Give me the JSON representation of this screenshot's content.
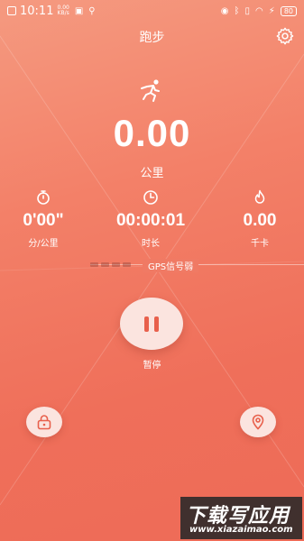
{
  "status_bar": {
    "time": "10:11",
    "net_speed": "0.00",
    "net_unit": "KB/s",
    "battery": "80"
  },
  "header": {
    "title": "跑步"
  },
  "distance": {
    "value": "0.00",
    "unit": "公里"
  },
  "stats": {
    "pace": {
      "value": "0'00\"",
      "label": "分/公里"
    },
    "duration": {
      "value": "00:00:01",
      "label": "时长"
    },
    "calories": {
      "value": "0.00",
      "label": "千卡"
    }
  },
  "gps": {
    "text": "GPS信号弱"
  },
  "controls": {
    "pause_label": "暂停"
  },
  "watermark": {
    "main": "下载写应用",
    "sub": "www.xiazaimao.com"
  },
  "icons": {
    "runner": "runner-icon",
    "settings": "gear-icon",
    "stopwatch": "stopwatch-icon",
    "clock": "clock-icon",
    "flame": "flame-icon",
    "lock": "lock-icon",
    "map": "map-pin-icon"
  },
  "colors": {
    "background_top": "#f59a80",
    "background_bottom": "#ee6b57",
    "button_face": "#fbe4df",
    "accent": "#e8604c"
  }
}
